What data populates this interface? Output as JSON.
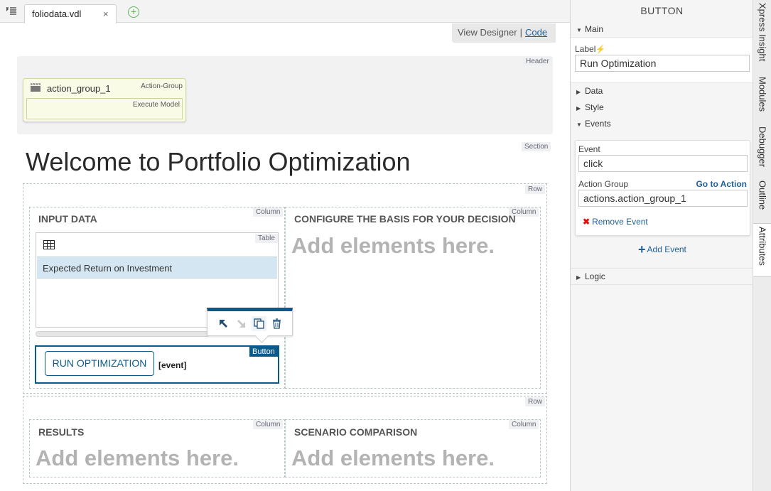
{
  "tabbar": {
    "file_tab": "foliodata.vdl",
    "close": "×",
    "add": "+"
  },
  "view_switch": {
    "designer": "View Designer",
    "separator": "|",
    "code": "Code"
  },
  "tags": {
    "header": "Header",
    "section": "Section",
    "row": "Row",
    "column": "Column",
    "table": "Table",
    "button": "Button"
  },
  "action_group": {
    "name": "action_group_1",
    "type": "Action-Group",
    "inner": "Execute Model"
  },
  "page_title": "Welcome to Portfolio Optimization",
  "row1": {
    "col1_title": "INPUT DATA",
    "col2_title": "CONFIGURE THE BASIS FOR YOUR DECISION",
    "col2_placeholder": "Add elements here."
  },
  "table": {
    "header_cell": "Expected Return on Investment"
  },
  "button_widget": {
    "label": "RUN OPTIMIZATION",
    "event_text": "[event]"
  },
  "row2": {
    "col1_title": "RESULTS",
    "col1_placeholder": "Add elements here.",
    "col2_title": "SCENARIO COMPARISON",
    "col2_placeholder": "Add elements here."
  },
  "panel": {
    "title": "BUTTON",
    "main": "Main",
    "label_field_label": "Label",
    "label_value": "Run Optimization",
    "data": "Data",
    "style": "Style",
    "events": "Events",
    "event_label": "Event",
    "event_value": "click",
    "action_group_label": "Action Group",
    "go_to_action": "Go to Action",
    "action_group_value": "actions.action_group_1",
    "remove_event": "Remove Event",
    "add_event": "Add Event",
    "logic": "Logic"
  },
  "side_tabs": [
    "Xpress Insight",
    "Modules",
    "Debugger",
    "Outline",
    "Attributes"
  ],
  "colors": {
    "accent": "#0c5a8c",
    "link": "#1f5f99",
    "placeholder": "#b3b3b3",
    "table_header": "#d3e6f1"
  },
  "icons": [
    "menu-icon",
    "close-icon",
    "add-tab-icon",
    "clapperboard-icon",
    "table-icon",
    "select-parent-icon",
    "select-child-icon",
    "duplicate-icon",
    "trash-icon",
    "lightning-icon",
    "caret-icon",
    "remove-x-icon",
    "plus-icon"
  ]
}
